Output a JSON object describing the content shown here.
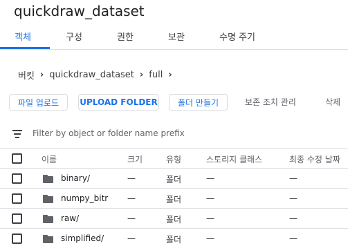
{
  "bucket": {
    "title": "quickdraw_dataset"
  },
  "tabs": [
    {
      "label": "객체",
      "active": true
    },
    {
      "label": "구성",
      "active": false
    },
    {
      "label": "권한",
      "active": false
    },
    {
      "label": "보관",
      "active": false
    },
    {
      "label": "수명 주기",
      "active": false
    }
  ],
  "breadcrumb": {
    "root": "버킷",
    "bucket": "quickdraw_dataset",
    "folder": "full",
    "separator": "›"
  },
  "actions": {
    "upload_files": "파일 업로드",
    "upload_folder": "UPLOAD FOLDER",
    "create_folder": "폴더 만들기",
    "retention": "보존 조치 관리",
    "delete": "삭제"
  },
  "filter": {
    "placeholder": "Filter by object or folder name prefix"
  },
  "table": {
    "columns": {
      "name": "이름",
      "size": "크기",
      "type": "유형",
      "storage_class": "스토리지 클래스",
      "last_modified": "최종 수정 날짜"
    },
    "rows": [
      {
        "name": "binary/",
        "size": "—",
        "type": "폴더",
        "storage_class": "—",
        "last_modified": "—"
      },
      {
        "name": "numpy_bitr",
        "size": "—",
        "type": "폴더",
        "storage_class": "—",
        "last_modified": "—"
      },
      {
        "name": "raw/",
        "size": "—",
        "type": "폴더",
        "storage_class": "—",
        "last_modified": "—"
      },
      {
        "name": "simplified/",
        "size": "—",
        "type": "폴더",
        "storage_class": "—",
        "last_modified": "—"
      }
    ]
  },
  "colors": {
    "accent": "#1a73e8",
    "text": "#202124",
    "muted": "#5f6368",
    "divider": "#dadce0"
  }
}
